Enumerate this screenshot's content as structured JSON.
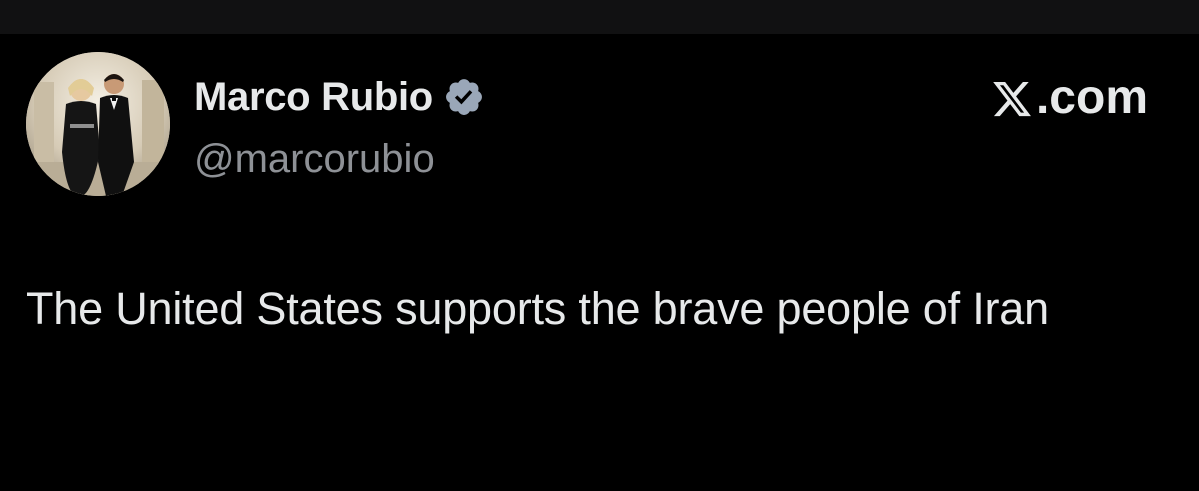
{
  "tweet": {
    "author": {
      "display_name": "Marco Rubio",
      "handle": "@marcorubio",
      "verified": true,
      "verified_badge_color": "#9aa7b8"
    },
    "brand": {
      "text": ".com",
      "logo_icon": "x-logo-icon"
    },
    "text": "The United States supports the brave people of Iran"
  },
  "theme": {
    "background": "#000000",
    "text_primary": "#e7e9ea",
    "text_secondary": "#8e9196"
  }
}
